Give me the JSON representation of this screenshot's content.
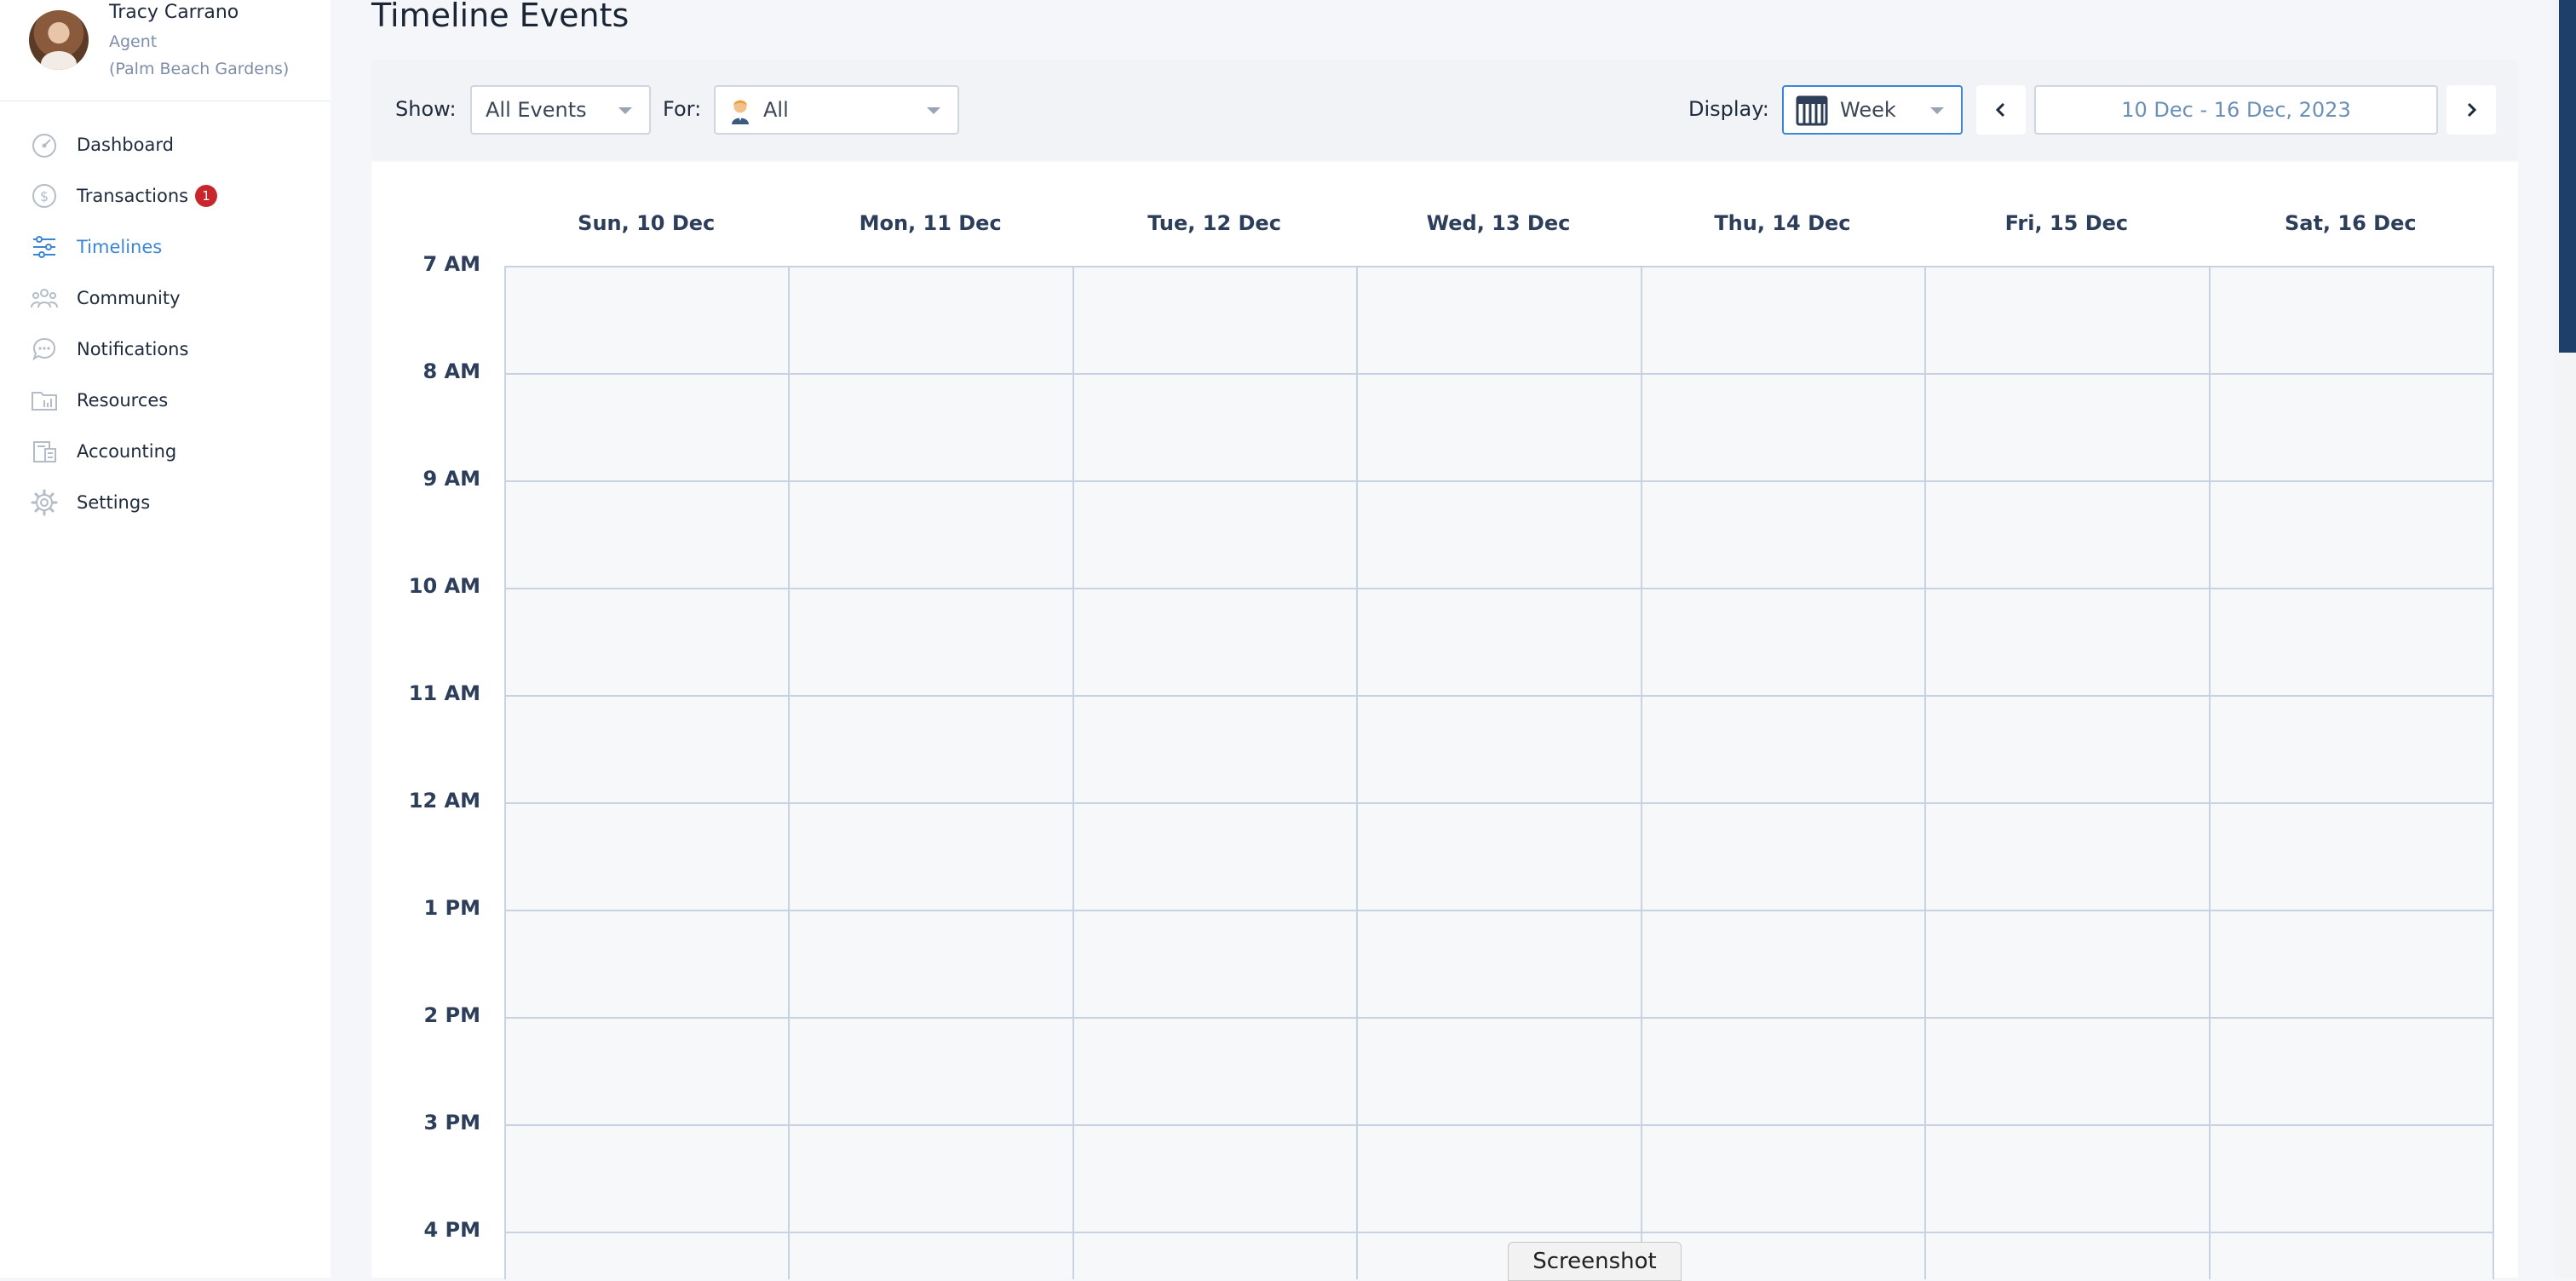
{
  "profile": {
    "name": "Tracy Carrano",
    "role": "Agent",
    "office": "(Palm Beach Gardens)"
  },
  "sidebar": {
    "items": [
      {
        "label": "Dashboard",
        "icon": "dashboard-icon",
        "active": false
      },
      {
        "label": "Transactions",
        "icon": "dollar-icon",
        "active": false,
        "badge": "1"
      },
      {
        "label": "Timelines",
        "icon": "timeline-icon",
        "active": true
      },
      {
        "label": "Community",
        "icon": "community-icon",
        "active": false
      },
      {
        "label": "Notifications",
        "icon": "chat-bubble-icon",
        "active": false
      },
      {
        "label": "Resources",
        "icon": "folder-icon",
        "active": false
      },
      {
        "label": "Accounting",
        "icon": "accounting-icon",
        "active": false
      },
      {
        "label": "Settings",
        "icon": "gear-icon",
        "active": false
      }
    ]
  },
  "page": {
    "title": "Timeline Events"
  },
  "toolbar": {
    "show_label": "Show:",
    "show_value": "All Events",
    "for_label": "For:",
    "for_value": "All",
    "display_label": "Display:",
    "display_value": "Week",
    "date_range": "10 Dec - 16 Dec, 2023"
  },
  "calendar": {
    "days": [
      "Sun, 10 Dec",
      "Mon, 11 Dec",
      "Tue, 12 Dec",
      "Wed, 13 Dec",
      "Thu, 14 Dec",
      "Fri, 15 Dec",
      "Sat, 16 Dec"
    ],
    "hours": [
      "7 AM",
      "8 AM",
      "9 AM",
      "10 AM",
      "11 AM",
      "12 AM",
      "1 PM",
      "2 PM",
      "3 PM",
      "4 PM"
    ]
  },
  "overlay": {
    "screenshot_label": "Screenshot"
  },
  "colors": {
    "accent": "#3a86d4",
    "badge": "#c9252c",
    "grid_line": "#c7d2e2",
    "text": "#2c3e5a"
  }
}
